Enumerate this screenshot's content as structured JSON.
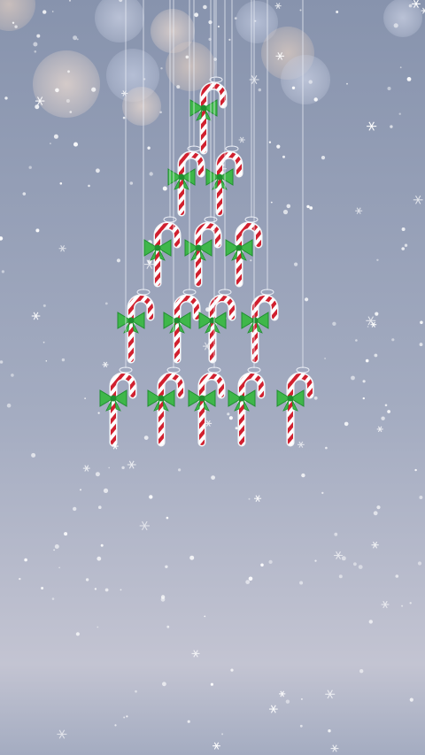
{
  "scene": {
    "kind": "wallpaper",
    "background": {
      "top": "#8793ad",
      "middle": "#a4acc1",
      "bottom": "#c3c4d2"
    },
    "bokeh_colors": [
      "#d9c9c0",
      "#c6cde0",
      "#e6d7cf",
      "#bfc8de"
    ],
    "tree": {
      "rows": [
        1,
        2,
        3,
        4,
        5
      ],
      "ornament": "candy-cane-with-green-bow",
      "colors": {
        "stripe_red": "#d1202f",
        "cane_white": "#ffffff",
        "bow_green": "#3fb74a",
        "bow_dark": "#1f8f30",
        "string": "#e8ecf4"
      }
    },
    "snow": {
      "color": "#ffffff",
      "style": "falling-snowflakes"
    }
  }
}
